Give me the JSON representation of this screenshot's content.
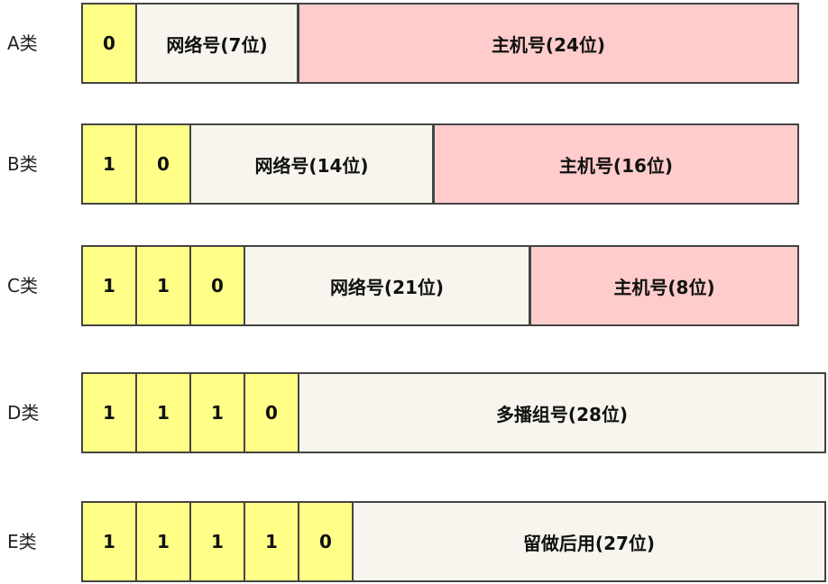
{
  "colors": {
    "bit": "#ffff88",
    "network": "#f7f5ee",
    "host": "#ffcccc",
    "border": "#444444"
  },
  "rows": [
    {
      "label": "A类",
      "bits": [
        "0"
      ],
      "fields": [
        {
          "text": "网络号(7位)",
          "kind": "net"
        },
        {
          "text": "主机号(24位)",
          "kind": "host"
        }
      ]
    },
    {
      "label": "B类",
      "bits": [
        "1",
        "0"
      ],
      "fields": [
        {
          "text": "网络号(14位)",
          "kind": "net"
        },
        {
          "text": "主机号(16位)",
          "kind": "host"
        }
      ]
    },
    {
      "label": "C类",
      "bits": [
        "1",
        "1",
        "0"
      ],
      "fields": [
        {
          "text": "网络号(21位)",
          "kind": "net"
        },
        {
          "text": "主机号(8位)",
          "kind": "host"
        }
      ]
    },
    {
      "label": "D类",
      "bits": [
        "1",
        "1",
        "1",
        "0"
      ],
      "fields": [
        {
          "text": "多播组号(28位)",
          "kind": "net"
        }
      ]
    },
    {
      "label": "E类",
      "bits": [
        "1",
        "1",
        "1",
        "1",
        "0"
      ],
      "fields": [
        {
          "text": "留做后用(27位)",
          "kind": "net"
        }
      ]
    }
  ]
}
